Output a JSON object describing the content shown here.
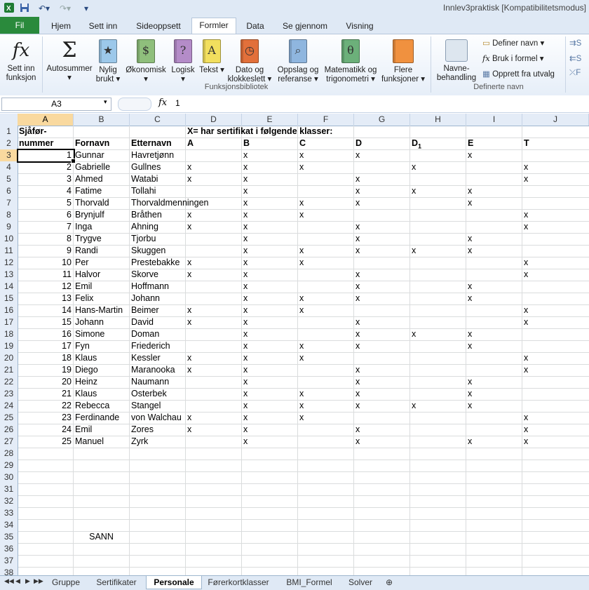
{
  "window": {
    "title": "Innlev3praktisk  [Kompatibilitetsmodus]"
  },
  "qat": {
    "save_icon": "save-icon",
    "undo_icon": "undo-icon",
    "redo_icon": "redo-icon"
  },
  "tabs": {
    "file": "Fil",
    "items": [
      "Hjem",
      "Sett inn",
      "Sideoppsett",
      "Formler",
      "Data",
      "Se gjennom",
      "Visning"
    ],
    "active": "Formler"
  },
  "ribbon": {
    "insert_function": {
      "line1": "Sett inn",
      "line2": "funksjon"
    },
    "autosum": {
      "line1": "Autosummer",
      "line2": ""
    },
    "recent": {
      "line1": "Nylig",
      "line2": "brukt"
    },
    "financial": {
      "line1": "Økonomisk",
      "line2": ""
    },
    "logical": {
      "line1": "Logisk",
      "line2": ""
    },
    "text": {
      "line1": "Tekst",
      "line2": ""
    },
    "datetime": {
      "line1": "Dato og",
      "line2": "klokkeslett"
    },
    "lookup": {
      "line1": "Oppslag og",
      "line2": "referanse"
    },
    "math": {
      "line1": "Matematikk og",
      "line2": "trigonometri"
    },
    "more": {
      "line1": "Flere",
      "line2": "funksjoner"
    },
    "library_label": "Funksjonsbibliotek",
    "name_manager": {
      "line1": "Navne-",
      "line2": "behandling"
    },
    "define_name": "Definer navn",
    "use_in_formula": "Bruk i formel",
    "create_from_selection": "Opprett fra utvalg",
    "defined_names_label": "Definerte navn"
  },
  "formula_bar": {
    "name_box": "A3",
    "fx": "fx",
    "content": "1"
  },
  "columns": [
    "A",
    "B",
    "C",
    "D",
    "E",
    "F",
    "G",
    "H",
    "I",
    "J"
  ],
  "rows": [
    [
      "1",
      "Sjåfør-",
      "",
      "",
      "X= har sertifikat i følgende klasser:",
      "",
      "",
      "",
      "",
      "",
      ""
    ],
    [
      "2",
      "nummer",
      "Fornavn",
      "Etternavn",
      "A",
      "B",
      "C",
      "D",
      "D1",
      "E",
      "T"
    ],
    [
      "3",
      "1",
      "Gunnar",
      "Havretjønn",
      "",
      "x",
      "x",
      "x",
      "",
      "x",
      ""
    ],
    [
      "4",
      "2",
      "Gabrielle",
      "Gullnes",
      "x",
      "x",
      "x",
      "",
      "x",
      "",
      "x"
    ],
    [
      "5",
      "3",
      "Ahmed",
      "Watabi",
      "x",
      "x",
      "",
      "x",
      "",
      "",
      "x"
    ],
    [
      "6",
      "4",
      "Fatime",
      "Tollahi",
      "",
      "x",
      "",
      "x",
      "x",
      "x",
      ""
    ],
    [
      "7",
      "5",
      "Thorvald",
      "Thorvaldmenningen",
      "",
      "x",
      "x",
      "x",
      "",
      "x",
      ""
    ],
    [
      "8",
      "6",
      "Brynjulf",
      "Bråthen",
      "x",
      "x",
      "x",
      "",
      "",
      "",
      "x"
    ],
    [
      "9",
      "7",
      "Inga",
      "Ahning",
      "x",
      "x",
      "",
      "x",
      "",
      "",
      "x"
    ],
    [
      "10",
      "8",
      "Trygve",
      "Tjorbu",
      "",
      "x",
      "",
      "x",
      "",
      "x",
      ""
    ],
    [
      "11",
      "9",
      "Randi",
      "Skuggen",
      "",
      "x",
      "x",
      "x",
      "x",
      "x",
      ""
    ],
    [
      "12",
      "10",
      "Per",
      "Prestebakke",
      "x",
      "x",
      "x",
      "",
      "",
      "",
      "x"
    ],
    [
      "13",
      "11",
      "Halvor",
      "Skorve",
      "x",
      "x",
      "",
      "x",
      "",
      "",
      "x"
    ],
    [
      "14",
      "12",
      "Emil",
      "Hoffmann",
      "",
      "x",
      "",
      "x",
      "",
      "x",
      ""
    ],
    [
      "15",
      "13",
      "Felix",
      "Johann",
      "",
      "x",
      "x",
      "x",
      "",
      "x",
      ""
    ],
    [
      "16",
      "14",
      "Hans-Martin",
      "Beimer",
      "x",
      "x",
      "x",
      "",
      "",
      "",
      "x"
    ],
    [
      "17",
      "15",
      "Johann",
      "David",
      "x",
      "x",
      "",
      "x",
      "",
      "",
      "x"
    ],
    [
      "18",
      "16",
      "Simone",
      "Doman",
      "",
      "x",
      "",
      "x",
      "x",
      "x",
      ""
    ],
    [
      "19",
      "17",
      "Fyn",
      "Friederich",
      "",
      "x",
      "x",
      "x",
      "",
      "x",
      ""
    ],
    [
      "20",
      "18",
      "Klaus",
      "Kessler",
      "x",
      "x",
      "x",
      "",
      "",
      "",
      "x"
    ],
    [
      "21",
      "19",
      "Diego",
      "Maranooka",
      "x",
      "x",
      "",
      "x",
      "",
      "",
      "x"
    ],
    [
      "22",
      "20",
      "Heinz",
      "Naumann",
      "",
      "x",
      "",
      "x",
      "",
      "x",
      ""
    ],
    [
      "23",
      "21",
      "Klaus",
      "Osterbek",
      "",
      "x",
      "x",
      "x",
      "",
      "x",
      ""
    ],
    [
      "24",
      "22",
      "Rebecca",
      "Stangel",
      "",
      "x",
      "x",
      "x",
      "x",
      "x",
      ""
    ],
    [
      "25",
      "23",
      "Ferdinande",
      "von Walchau",
      "x",
      "x",
      "x",
      "",
      "",
      "",
      "x"
    ],
    [
      "26",
      "24",
      "Emil",
      "Zores",
      "x",
      "x",
      "",
      "x",
      "",
      "",
      "x"
    ],
    [
      "27",
      "25",
      "Manuel",
      "Zyrk",
      "",
      "x",
      "",
      "x",
      "",
      "x",
      "x"
    ],
    [
      "28",
      "",
      "",
      "",
      "",
      "",
      "",
      "",
      "",
      "",
      ""
    ],
    [
      "29",
      "",
      "",
      "",
      "",
      "",
      "",
      "",
      "",
      "",
      ""
    ],
    [
      "30",
      "",
      "",
      "",
      "",
      "",
      "",
      "",
      "",
      "",
      ""
    ],
    [
      "31",
      "",
      "",
      "",
      "",
      "",
      "",
      "",
      "",
      "",
      ""
    ],
    [
      "32",
      "",
      "",
      "",
      "",
      "",
      "",
      "",
      "",
      "",
      ""
    ],
    [
      "33",
      "",
      "",
      "",
      "",
      "",
      "",
      "",
      "",
      "",
      ""
    ],
    [
      "34",
      "",
      "",
      "",
      "",
      "",
      "",
      "",
      "",
      "",
      ""
    ],
    [
      "35",
      "",
      "SANN",
      "",
      "",
      "",
      "",
      "",
      "",
      "",
      ""
    ],
    [
      "36",
      "",
      "",
      "",
      "",
      "",
      "",
      "",
      "",
      "",
      ""
    ],
    [
      "37",
      "",
      "",
      "",
      "",
      "",
      "",
      "",
      "",
      "",
      ""
    ],
    [
      "38",
      "",
      "",
      "",
      "",
      "",
      "",
      "",
      "",
      "",
      ""
    ]
  ],
  "selected_cell": {
    "row": "3",
    "col": "A"
  },
  "sheet_tabs": [
    "Gruppe",
    "Sertifikater",
    "Personale",
    "Førerkortklasser",
    "BMI_Formel",
    "Solver"
  ],
  "active_sheet": "Personale",
  "colors": {
    "file_tab": "#2a8a3c",
    "header_bg": "#e4ecf7",
    "selected_header": "#f9d99f",
    "grid_line": "#dadcdd"
  }
}
